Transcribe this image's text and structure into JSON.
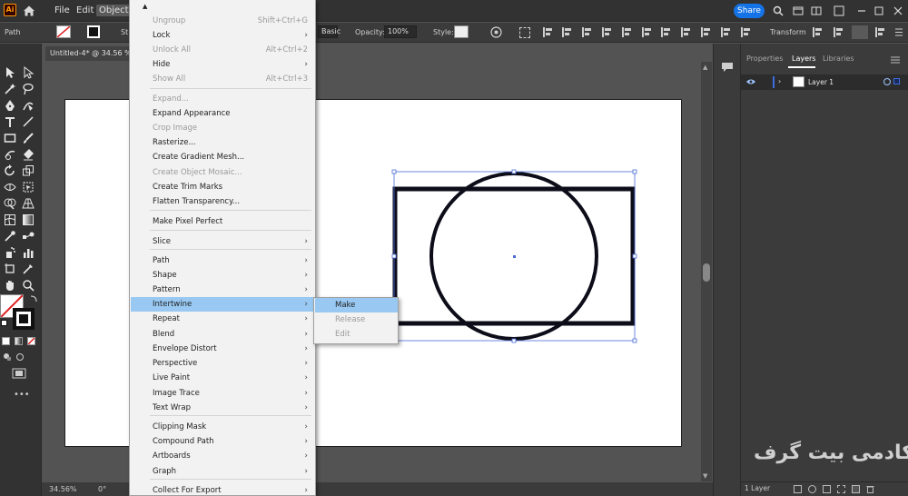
{
  "menubar": {
    "app_logo": "Ai",
    "items": [
      "File",
      "Edit",
      "Object"
    ],
    "share_label": "Share",
    "icons": [
      "search-icon",
      "minimize-icon",
      "restore-icon",
      "close-icon"
    ]
  },
  "controlbar": {
    "selection_label": "Path",
    "style_truncated": "St",
    "stroke_profile": "Basic",
    "opacity_label": "Opacity:",
    "opacity_value": "100%",
    "style_label": "Style:",
    "transform_label": "Transform"
  },
  "document": {
    "tab_title": "Untitled-4* @ 34.56 %",
    "zoom": "34.56%",
    "rotation": "0°"
  },
  "object_menu": {
    "items": [
      {
        "label": "Ungroup",
        "shortcut": "Shift+Ctrl+G",
        "enabled": false,
        "submenu": false
      },
      {
        "label": "Lock",
        "shortcut": "",
        "enabled": true,
        "submenu": true
      },
      {
        "label": "Unlock All",
        "shortcut": "Alt+Ctrl+2",
        "enabled": false,
        "submenu": false
      },
      {
        "label": "Hide",
        "shortcut": "",
        "enabled": true,
        "submenu": true
      },
      {
        "label": "Show All",
        "shortcut": "Alt+Ctrl+3",
        "enabled": false,
        "submenu": false
      },
      {
        "label": "Expand...",
        "shortcut": "",
        "enabled": false,
        "submenu": false
      },
      {
        "label": "Expand Appearance",
        "shortcut": "",
        "enabled": true,
        "submenu": false
      },
      {
        "label": "Crop Image",
        "shortcut": "",
        "enabled": false,
        "submenu": false
      },
      {
        "label": "Rasterize...",
        "shortcut": "",
        "enabled": true,
        "submenu": false
      },
      {
        "label": "Create Gradient Mesh...",
        "shortcut": "",
        "enabled": true,
        "submenu": false
      },
      {
        "label": "Create Object Mosaic...",
        "shortcut": "",
        "enabled": false,
        "submenu": false
      },
      {
        "label": "Create Trim Marks",
        "shortcut": "",
        "enabled": true,
        "submenu": false
      },
      {
        "label": "Flatten Transparency...",
        "shortcut": "",
        "enabled": true,
        "submenu": false
      },
      {
        "label": "Make Pixel Perfect",
        "shortcut": "",
        "enabled": true,
        "submenu": false
      },
      {
        "label": "Slice",
        "shortcut": "",
        "enabled": true,
        "submenu": true
      },
      {
        "label": "Path",
        "shortcut": "",
        "enabled": true,
        "submenu": true
      },
      {
        "label": "Shape",
        "shortcut": "",
        "enabled": true,
        "submenu": true
      },
      {
        "label": "Pattern",
        "shortcut": "",
        "enabled": true,
        "submenu": true
      },
      {
        "label": "Intertwine",
        "shortcut": "",
        "enabled": true,
        "submenu": true,
        "highlighted": true
      },
      {
        "label": "Repeat",
        "shortcut": "",
        "enabled": true,
        "submenu": true
      },
      {
        "label": "Blend",
        "shortcut": "",
        "enabled": true,
        "submenu": true
      },
      {
        "label": "Envelope Distort",
        "shortcut": "",
        "enabled": true,
        "submenu": true
      },
      {
        "label": "Perspective",
        "shortcut": "",
        "enabled": true,
        "submenu": true
      },
      {
        "label": "Live Paint",
        "shortcut": "",
        "enabled": true,
        "submenu": true
      },
      {
        "label": "Image Trace",
        "shortcut": "",
        "enabled": true,
        "submenu": true
      },
      {
        "label": "Text Wrap",
        "shortcut": "",
        "enabled": true,
        "submenu": true
      },
      {
        "label": "Clipping Mask",
        "shortcut": "",
        "enabled": true,
        "submenu": true
      },
      {
        "label": "Compound Path",
        "shortcut": "",
        "enabled": true,
        "submenu": true
      },
      {
        "label": "Artboards",
        "shortcut": "",
        "enabled": true,
        "submenu": true
      },
      {
        "label": "Graph",
        "shortcut": "",
        "enabled": true,
        "submenu": true
      },
      {
        "label": "Collect For Export",
        "shortcut": "",
        "enabled": true,
        "submenu": true
      }
    ]
  },
  "intertwine_submenu": {
    "items": [
      {
        "label": "Make",
        "enabled": true,
        "highlighted": true
      },
      {
        "label": "Release",
        "enabled": false
      },
      {
        "label": "Edit",
        "enabled": false
      }
    ]
  },
  "panel": {
    "tabs": [
      "Properties",
      "Layers",
      "Libraries"
    ],
    "active_tab": "Layers",
    "layer_name": "Layer 1",
    "footer_count": "1 Layer"
  },
  "watermark": "آکادمی بیت گرف",
  "colors": {
    "menu_highlight": "#99c9f2",
    "share_blue": "#1473e6",
    "selection_blue": "#4a6bd8"
  }
}
